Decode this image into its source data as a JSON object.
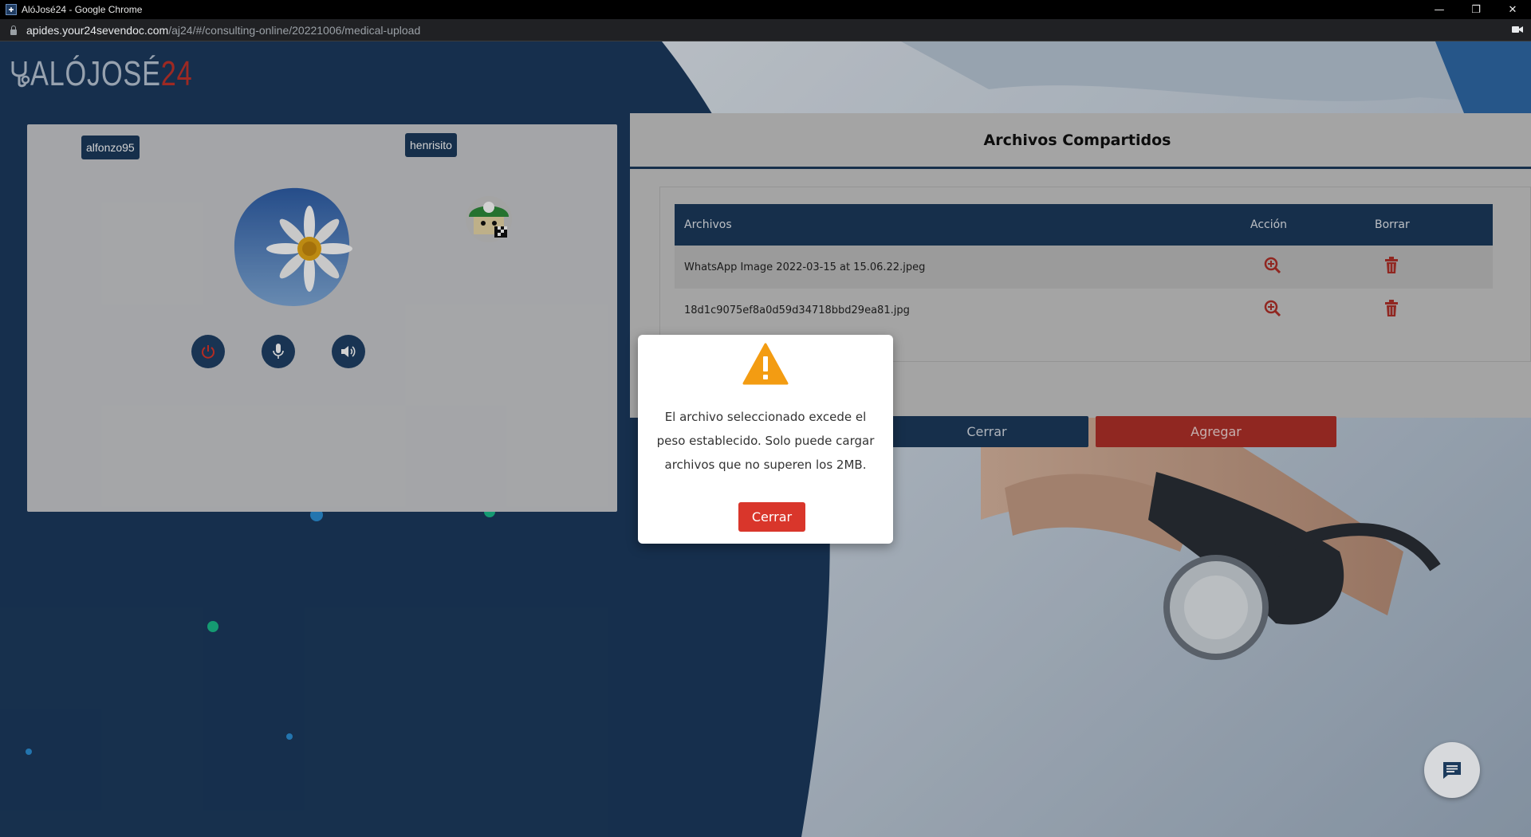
{
  "browser": {
    "window_title": "AlóJosé24 - Google Chrome",
    "url_host": "apides.your24sevendoc.com",
    "url_path": "/aj24/#/consulting-online/20221006/medical-upload"
  },
  "logo": {
    "text_main": "ALÓJOSÉ",
    "text_accent": "24"
  },
  "video": {
    "local_user": "alfonzo95",
    "remote_user": "henrisito"
  },
  "files": {
    "title": "Archivos Compartidos",
    "columns": [
      "Archivos",
      "Acción",
      "Borrar"
    ],
    "rows": [
      {
        "name": "WhatsApp Image 2022-03-15 at 15.06.22.jpeg"
      },
      {
        "name": "18d1c9075ef8a0d59d34718bbd29ea81.jpg"
      }
    ],
    "close_label": "Cerrar",
    "add_label": "Agregar"
  },
  "modal": {
    "message": "El archivo seleccionado excede el peso establecido. Solo puede cargar archivos que no superen los 2MB.",
    "button_label": "Cerrar"
  },
  "colors": {
    "navy": "#1b3a5c",
    "accent_red": "#d9362b",
    "warning": "#f39c12"
  }
}
